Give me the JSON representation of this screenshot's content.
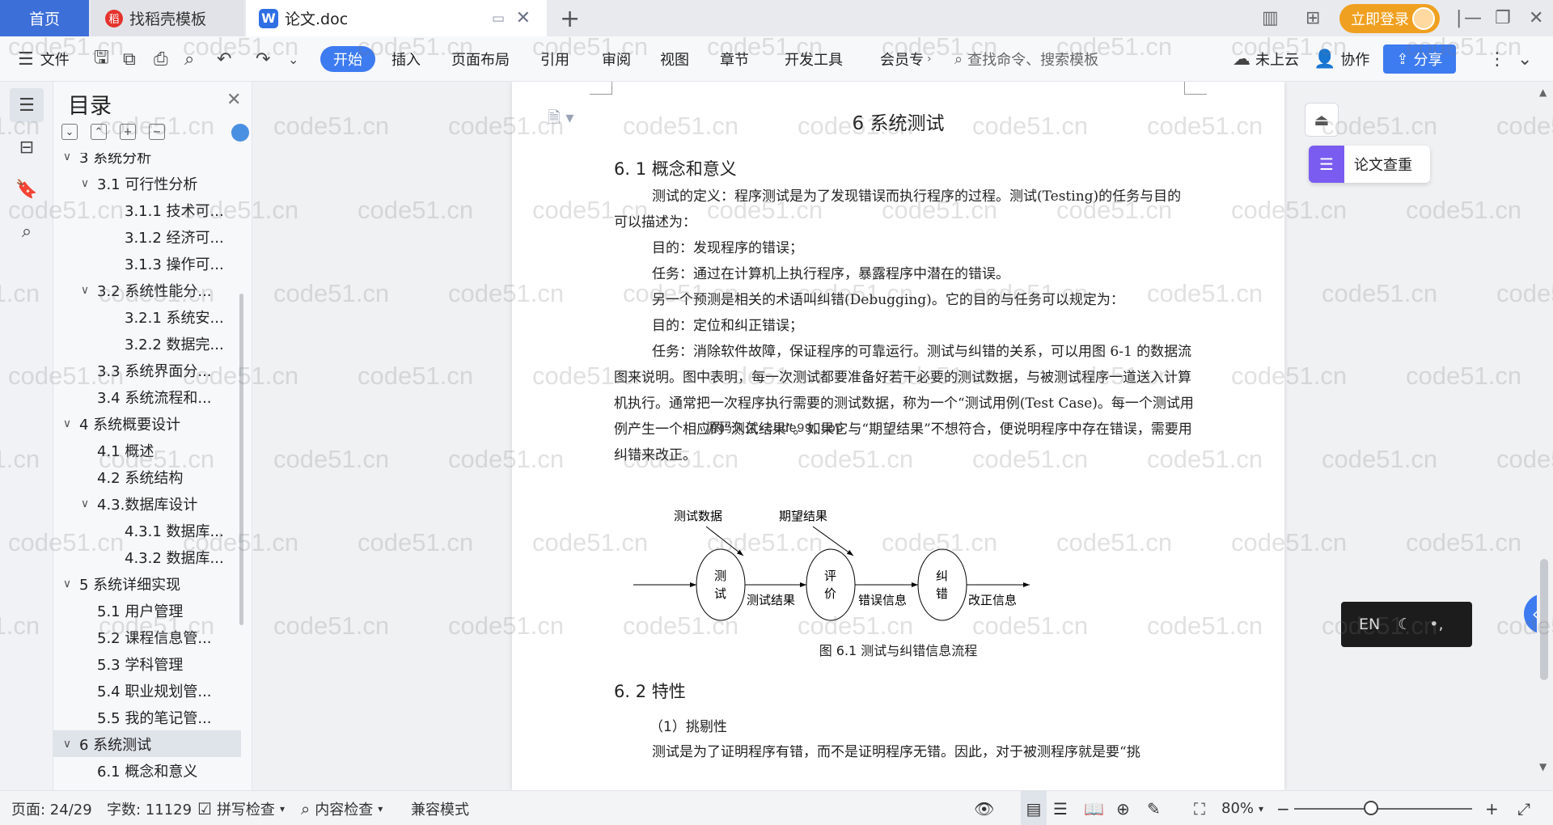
{
  "tabs": {
    "home": "首页",
    "daoke": "找稻壳模板",
    "doc": "论文.doc"
  },
  "titlebar": {
    "login": "立即登录"
  },
  "menubar": {
    "file": "文件",
    "items": [
      "开始",
      "插入",
      "页面布局",
      "引用",
      "审阅",
      "视图",
      "章节",
      "开发工具",
      "会员专"
    ],
    "search_placeholder": "查找命令、搜索模板",
    "cloud": "未上云",
    "collab": "协作",
    "share": "分享"
  },
  "toc": {
    "title": "目录",
    "items": [
      {
        "label": "3 系统分析",
        "level": 0,
        "caret": "∨"
      },
      {
        "label": "3.1 可行性分析",
        "level": 1,
        "caret": "∨"
      },
      {
        "label": "3.1.1 技术可...",
        "level": 2,
        "caret": ""
      },
      {
        "label": "3.1.2 经济可...",
        "level": 2,
        "caret": ""
      },
      {
        "label": "3.1.3 操作可...",
        "level": 2,
        "caret": ""
      },
      {
        "label": "3.2 系统性能分...",
        "level": 1,
        "caret": "∨"
      },
      {
        "label": "3.2.1  系统安...",
        "level": 2,
        "caret": ""
      },
      {
        "label": "3.2.2  数据完...",
        "level": 2,
        "caret": ""
      },
      {
        "label": "3.3 系统界面分...",
        "level": 1,
        "caret": ""
      },
      {
        "label": "3.4 系统流程和...",
        "level": 1,
        "caret": ""
      },
      {
        "label": "4 系统概要设计",
        "level": 0,
        "caret": "∨"
      },
      {
        "label": "4.1 概述",
        "level": 1,
        "caret": ""
      },
      {
        "label": "4.2 系统结构",
        "level": 1,
        "caret": ""
      },
      {
        "label": "4.3.数据库设计",
        "level": 1,
        "caret": "∨"
      },
      {
        "label": "4.3.1 数据库...",
        "level": 2,
        "caret": ""
      },
      {
        "label": "4.3.2 数据库...",
        "level": 2,
        "caret": ""
      },
      {
        "label": "5 系统详细实现",
        "level": 0,
        "caret": "∨"
      },
      {
        "label": "5.1  用户管理",
        "level": 1,
        "caret": ""
      },
      {
        "label": "5.2  课程信息管...",
        "level": 1,
        "caret": ""
      },
      {
        "label": "5.3  学科管理",
        "level": 1,
        "caret": ""
      },
      {
        "label": "5.4  职业规划管...",
        "level": 1,
        "caret": ""
      },
      {
        "label": "5.5  我的笔记管...",
        "level": 1,
        "caret": ""
      },
      {
        "label": "6 系统测试",
        "level": 0,
        "caret": "∨",
        "selected": true
      },
      {
        "label": "6.1 概念和意义",
        "level": 1,
        "caret": ""
      }
    ]
  },
  "document": {
    "title": "6 系统测试",
    "section1": "6. 1 概念和意义",
    "paragraphs": [
      "测试的定义：程序测试是为了发现错误而执行程序的过程。测试(Testing)的任务与目的可以描述为：",
      "目的：发现程序的错误；",
      "任务：通过在计算机上执行程序，暴露程序中潜在的错误。",
      "另一个预测是相关的术语叫纠错(Debugging)。它的目的与任务可以规定为：",
      "目的：定位和纠正错误；",
      "任务：消除软件故障，保证程序的可靠运行。测试与纠错的关系，可以用图 6-1 的数据流图来说明。图中表明，每一次测试都要准备好若干必要的测试数据，与被测试程序一道送入计算机执行。通常把一次程序执行需要的测试数据，称为一个“测试用例(Test Case)。每一个测试用例产生一个相应的“测试结果”。如果它与“期望结果”不想符合，便说明程序中存在错误，需要用纠错来改正。"
    ],
    "overlay_text": "源码久久-code99.top",
    "diagram": {
      "input1": "测试数据",
      "input2": "期望结果",
      "node1": "测\n试",
      "node2": "评\n价",
      "node3": "纠\n错",
      "edge1": "测试结果",
      "edge2": "错误信息",
      "edge3": "改正信息"
    },
    "figure_caption": "图 6.1 测试与纠错信息流程",
    "section2": "6. 2 特性",
    "item1": "（1）挑剔性",
    "partial_line": "测试是为了证明程序有错，而不是证明程序无错。因此，对于被测程序就是要“挑"
  },
  "watermark": "code51.cn",
  "right_panel": {
    "lunwen": "论文查重",
    "ime": "EN"
  },
  "statusbar": {
    "page": "页面: 24/29",
    "words": "字数: 11129",
    "spell": "拼写检查",
    "content": "内容检查",
    "compat": "兼容模式",
    "zoom": "80%"
  }
}
